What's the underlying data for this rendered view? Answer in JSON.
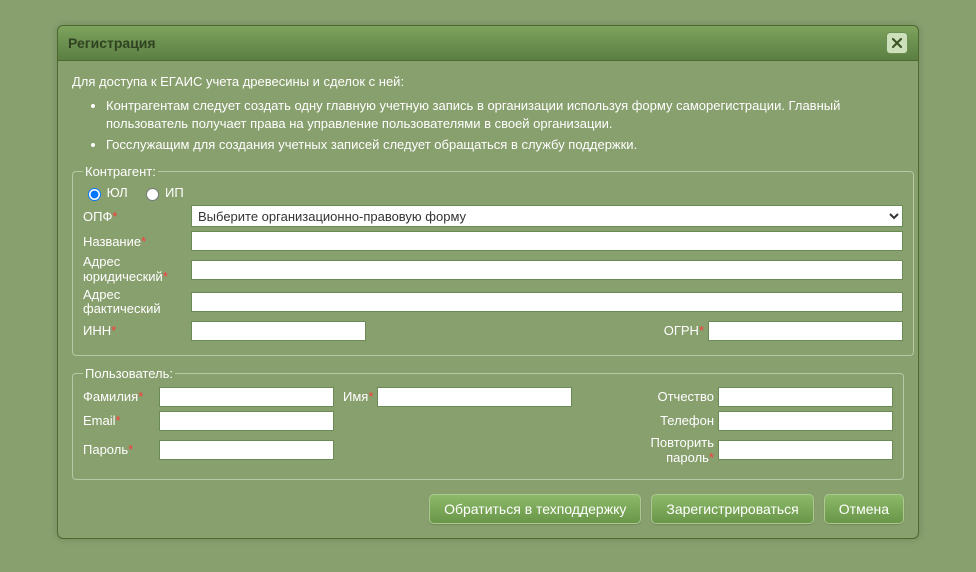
{
  "dialog": {
    "title": "Регистрация"
  },
  "info": {
    "intro": "Для доступа к ЕГАИС учета древесины и сделок с ней:",
    "point1": "Контрагентам следует создать одну главную учетную запись в организации используя форму саморегистрации. Главный пользователь получает права на управление пользователями в своей организации.",
    "point2": "Госслужащим для создания учетных записей следует обращаться в службу поддержки."
  },
  "contragent": {
    "legend": "Контрагент:",
    "radio_ul": "ЮЛ",
    "radio_ip": "ИП",
    "opf_label": "ОПФ",
    "opf_placeholder": "Выберите организационно-правовую форму",
    "name_label": "Название",
    "legal_addr_label": "Адрес юридический",
    "fact_addr_label": "Адрес фактический",
    "inn_label": "ИНН",
    "ogrn_label": "ОГРН",
    "values": {
      "opf": "",
      "name": "",
      "legal_addr": "",
      "fact_addr": "",
      "inn": "",
      "ogrn": ""
    }
  },
  "user": {
    "legend": "Пользователь:",
    "lastname_label": "Фамилия",
    "firstname_label": "Имя",
    "patronymic_label": "Отчество",
    "email_label": "Email",
    "phone_label": "Телефон",
    "password_label": "Пароль",
    "password2_label": "Повторить пароль",
    "values": {
      "lastname": "",
      "firstname": "",
      "patronymic": "",
      "email": "",
      "phone": "",
      "password": "",
      "password2": ""
    }
  },
  "buttons": {
    "support": "Обратиться в техподдержку",
    "register": "Зарегистрироваться",
    "cancel": "Отмена"
  }
}
